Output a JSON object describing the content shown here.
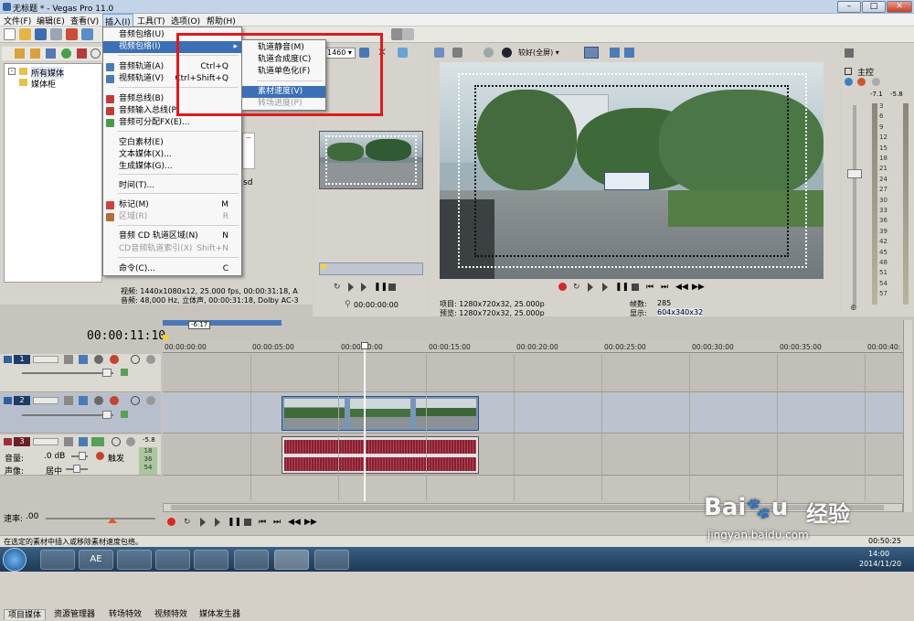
{
  "title": "无标题 * - Vegas Pro 11.0",
  "menubar": [
    "文件(F)",
    "编辑(E)",
    "查看(V)",
    "插入(I)",
    "工具(T)",
    "选项(O)",
    "帮助(H)"
  ],
  "insert_menu": [
    {
      "label": "音频包络(U)",
      "shortcut": "",
      "disabled": false,
      "highlight": false
    },
    {
      "label": "视频包络(I)",
      "shortcut": "",
      "disabled": false,
      "highlight": true,
      "submenu": true
    },
    {
      "label": "音频轨道(A)",
      "shortcut": "Ctrl+Q",
      "disabled": false,
      "highlight": false
    },
    {
      "label": "视频轨道(V)",
      "shortcut": "Ctrl+Shift+Q",
      "disabled": false,
      "highlight": false
    },
    {
      "label": "音频总线(B)",
      "shortcut": "",
      "disabled": false,
      "highlight": false
    },
    {
      "label": "音频输入总线(P)",
      "shortcut": "",
      "disabled": false,
      "highlight": false
    },
    {
      "label": "音频可分配FX(E)...",
      "shortcut": "",
      "disabled": false,
      "highlight": false
    },
    {
      "label": "空白素材(E)",
      "shortcut": "",
      "disabled": false,
      "highlight": false
    },
    {
      "label": "文本媒体(X)...",
      "shortcut": "",
      "disabled": false,
      "highlight": false
    },
    {
      "label": "生成媒体(G)...",
      "shortcut": "",
      "disabled": false,
      "highlight": false
    },
    {
      "label": "时间(T)...",
      "shortcut": "",
      "disabled": false,
      "highlight": false
    },
    {
      "label": "标记(M)",
      "shortcut": "M",
      "disabled": false,
      "highlight": false
    },
    {
      "label": "区域(R)",
      "shortcut": "R",
      "disabled": true,
      "highlight": false
    },
    {
      "label": "音频 CD 轨道区域(N)",
      "shortcut": "N",
      "disabled": false,
      "highlight": false
    },
    {
      "label": "CD音频轨道索引(X)",
      "shortcut": "Shift+N",
      "disabled": true,
      "highlight": false
    },
    {
      "label": "命令(C)...",
      "shortcut": "C",
      "disabled": false,
      "highlight": false
    }
  ],
  "video_submenu": [
    {
      "label": "轨道静音(M)",
      "disabled": false,
      "highlight": false
    },
    {
      "label": "轨道合成度(C)",
      "disabled": false,
      "highlight": false
    },
    {
      "label": "轨道单色化(F)",
      "disabled": false,
      "highlight": false
    },
    {
      "label": "素材速度(V)",
      "disabled": false,
      "highlight": true
    },
    {
      "label": "转场进度(P)",
      "disabled": true,
      "highlight": false
    }
  ],
  "media_tree": {
    "items": [
      "所有媒体",
      "媒体柜"
    ]
  },
  "media_info": {
    "video": "视频: 1440x1080x12, 25.000 fps, 00:00:31:18, A",
    "audio": "音频: 48,000 Hz, 立体声, 00:00:31:18, Dolby AC-3",
    "sd": "sd"
  },
  "bottom_tabs": [
    "项目媒体",
    "资源管理器",
    "转场特效",
    "视频特效",
    "媒体发生器"
  ],
  "trimmer": {
    "time": "00:00:00:00",
    "zoom": "1460"
  },
  "preview": {
    "quality": "较好(全屏)",
    "project": "项目: 1280x720x32, 25.000p",
    "preview": "预览: 1280x720x32, 25.000p",
    "frame_label": "帧数:",
    "frame": "285",
    "display_label": "显示:",
    "display": "604x340x32"
  },
  "master": {
    "label": "主控",
    "left": "-7.1",
    "right": "-5.8",
    "scale": [
      "3",
      "6",
      "9",
      "12",
      "15",
      "18",
      "21",
      "24",
      "27",
      "30",
      "33",
      "36",
      "39",
      "42",
      "45",
      "48",
      "51",
      "54",
      "57"
    ]
  },
  "timeline": {
    "timecode": "00:00:11:10",
    "marker": "-6:17",
    "ticks": [
      "00:00:00:00",
      "00:00:05:00",
      "00:00:10:00",
      "00:00:15:00",
      "00:00:20:00",
      "00:00:25:00",
      "00:00:30:00",
      "00:00:35:00",
      "00:00:40:"
    ]
  },
  "tracks": [
    {
      "num": "1",
      "type": "video"
    },
    {
      "num": "2",
      "type": "video"
    },
    {
      "num": "3",
      "type": "audio",
      "vol_label": "音量:",
      "vol": ".0 dB",
      "pan_label": "声像:",
      "pan": "居中",
      "touch": "触发",
      "meter": [
        "-5.8",
        "18",
        "36",
        "54"
      ]
    }
  ],
  "rate": {
    "label": "速率:",
    "value": ".00"
  },
  "statusbar": "在选定的素材中插入或移除素材速度包络。",
  "statusbar_right": "00:50:25",
  "clock": {
    "time": "14:00",
    "date": "2014/11/20"
  },
  "watermark": {
    "text": "经验",
    "url": "jingyan.baidu.com"
  }
}
